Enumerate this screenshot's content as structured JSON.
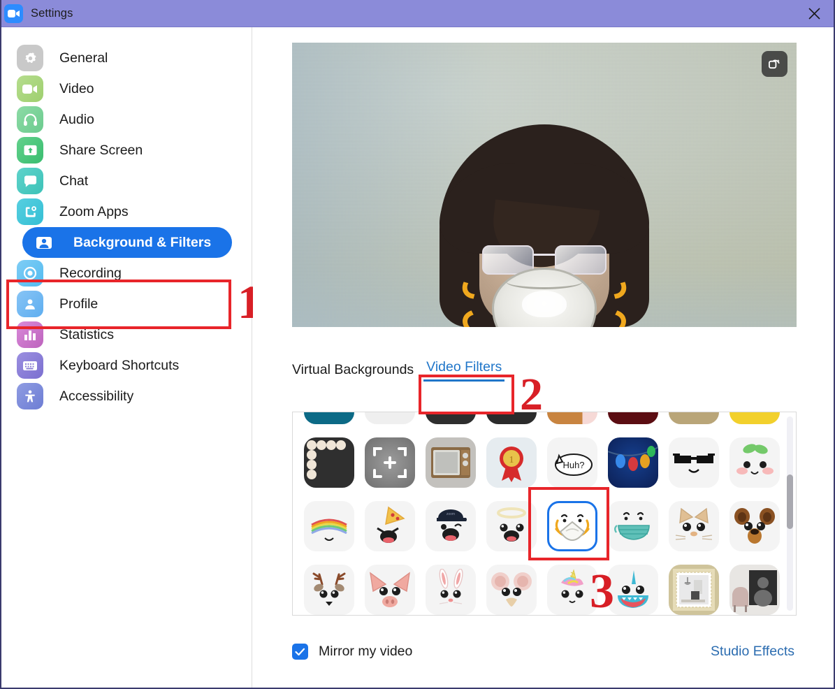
{
  "window": {
    "title": "Settings",
    "title_icon": "zoom-video-icon",
    "close_icon": "close-icon",
    "titlebar_color": "#8b8bd9"
  },
  "sidebar": {
    "items": [
      {
        "label": "General",
        "icon": "gear-icon",
        "color": "#c9c9c9",
        "active": false
      },
      {
        "label": "Video",
        "icon": "video-camera-icon",
        "color": "#a8d57f",
        "active": false
      },
      {
        "label": "Audio",
        "icon": "headphones-icon",
        "color": "#7fcf9b",
        "active": false
      },
      {
        "label": "Share Screen",
        "icon": "share-screen-icon",
        "color": "#4cc57f",
        "active": false
      },
      {
        "label": "Chat",
        "icon": "chat-bubble-icon",
        "color": "#4cc8bd",
        "active": false
      },
      {
        "label": "Zoom Apps",
        "icon": "zoom-apps-icon",
        "color": "#45c6d6",
        "active": false
      },
      {
        "label": "Background & Filters",
        "icon": "person-frame-icon",
        "color": "#1a73e8",
        "active": true
      },
      {
        "label": "Recording",
        "icon": "record-circle-icon",
        "color": "#64c0f0",
        "active": false
      },
      {
        "label": "Profile",
        "icon": "person-icon",
        "color": "#6fb8ef",
        "active": false
      },
      {
        "label": "Statistics",
        "icon": "bar-chart-icon",
        "color": "#c875c8",
        "active": false
      },
      {
        "label": "Keyboard Shortcuts",
        "icon": "keyboard-icon",
        "color": "#8b7fd4",
        "active": false
      },
      {
        "label": "Accessibility",
        "icon": "accessibility-icon",
        "color": "#7f8fd8",
        "active": false
      }
    ]
  },
  "preview": {
    "rotate_button_icon": "rotate-camera-icon",
    "description": "Self-view camera preview with N95 mask video filter applied"
  },
  "tabs": [
    {
      "label": "Virtual Backgrounds",
      "active": false
    },
    {
      "label": "Video Filters",
      "active": true
    }
  ],
  "filters": {
    "selected": "n95-mask",
    "partial_top_row": [
      "teal-thumbnail",
      "white-thumbnail",
      "dark-thumbnail",
      "dark-thumbnail",
      "tan-thumbnail",
      "dark-red-thumbnail",
      "beige-thumbnail",
      "yellow-pattern-thumbnail"
    ],
    "rows": [
      [
        {
          "name": "pearl-frame"
        },
        {
          "name": "focus-frame-plus"
        },
        {
          "name": "retro-tv"
        },
        {
          "name": "award-ribbon"
        },
        {
          "name": "huh-speech-bubble"
        },
        {
          "name": "string-lights"
        },
        {
          "name": "deal-with-it-sunglasses"
        },
        {
          "name": "leaf-peach-face"
        }
      ],
      [
        {
          "name": "rainbow-arc"
        },
        {
          "name": "pizza-slice-face"
        },
        {
          "name": "zoom-cap-face"
        },
        {
          "name": "angel-halo-face"
        },
        {
          "name": "n95-mask",
          "selected": true
        },
        {
          "name": "surgical-mask"
        },
        {
          "name": "cat-face"
        },
        {
          "name": "bear-face"
        }
      ],
      [
        {
          "name": "deer-antlers-face"
        },
        {
          "name": "pig-face"
        },
        {
          "name": "rabbit-face"
        },
        {
          "name": "mouse-face"
        },
        {
          "name": "unicorn-face"
        },
        {
          "name": "narwhal-face"
        },
        {
          "name": "picture-frame-room"
        },
        {
          "name": "portrait-frame-room"
        }
      ]
    ]
  },
  "bottom": {
    "mirror_label": "Mirror my video",
    "mirror_checked": true,
    "studio_effects_label": "Studio Effects"
  },
  "annotations": [
    {
      "number": "1",
      "target": "sidebar-item-background-filters"
    },
    {
      "number": "2",
      "target": "tab-video-filters"
    },
    {
      "number": "3",
      "target": "filter-n95-mask"
    }
  ],
  "colors": {
    "accent_blue": "#1a73e8",
    "annotation_red": "#e8252a",
    "link_blue": "#2b6cb0",
    "tab_active_blue": "#2076c9"
  }
}
